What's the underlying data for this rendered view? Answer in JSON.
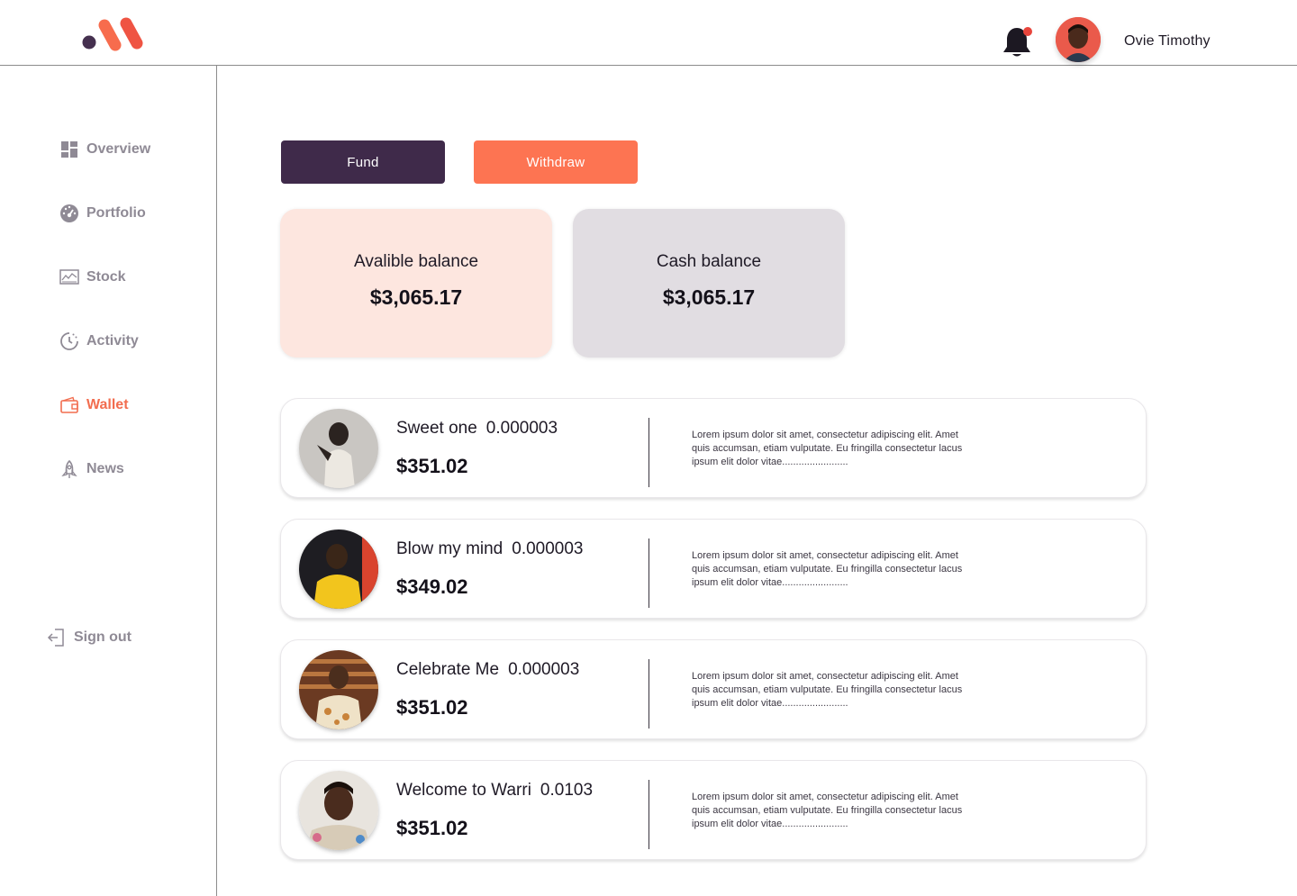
{
  "header": {
    "user_name": "Ovie Timothy",
    "notification_dot_color": "#e8453c"
  },
  "sidebar": {
    "items": [
      {
        "label": "Overview",
        "icon": "grid-icon",
        "active": false
      },
      {
        "label": "Portfolio",
        "icon": "dashboard-gauge-icon",
        "active": false
      },
      {
        "label": "Stock",
        "icon": "chart-screen-icon",
        "active": false
      },
      {
        "label": "Activity",
        "icon": "clock-icon",
        "active": false
      },
      {
        "label": "Wallet",
        "icon": "wallet-icon",
        "active": true
      },
      {
        "label": "News",
        "icon": "rocket-icon",
        "active": false
      }
    ],
    "signout_label": "Sign out"
  },
  "actions": {
    "fund_label": "Fund",
    "withdraw_label": "Withdraw"
  },
  "balances": {
    "available": {
      "label": "Avalible balance",
      "value": "$3,065.17"
    },
    "cash": {
      "label": "Cash balance",
      "value": "$3,065.17"
    }
  },
  "songs": [
    {
      "title": "Sweet one",
      "amount": "0.000003",
      "price": "$351.02",
      "description": "Lorem ipsum dolor sit amet, consectetur adipiscing elit. Amet quis accumsan, etiam vulputate. Eu fringilla consectetur lacus ipsum elit dolor vitae........................"
    },
    {
      "title": "Blow my mind",
      "amount": "0.000003",
      "price": "$349.02",
      "description": "Lorem ipsum dolor sit amet, consectetur adipiscing elit. Amet quis accumsan, etiam vulputate. Eu fringilla consectetur lacus ipsum elit dolor vitae........................"
    },
    {
      "title": "Celebrate Me",
      "amount": "0.000003",
      "price": "$351.02",
      "description": "Lorem ipsum dolor sit amet, consectetur adipiscing elit. Amet quis accumsan, etiam vulputate. Eu fringilla consectetur lacus ipsum elit dolor vitae........................"
    },
    {
      "title": "Welcome to Warri",
      "amount": "0.0103",
      "price": "$351.02",
      "description": "Lorem ipsum dolor sit amet, consectetur adipiscing elit. Amet quis accumsan, etiam vulputate. Eu fringilla consectetur lacus ipsum elit dolor vitae........................"
    }
  ],
  "colors": {
    "primary_dark": "#3f2a4a",
    "accent_orange": "#fd7452",
    "active_nav": "#f26d4f",
    "available_card_bg": "#fde6df",
    "cash_card_bg": "#e1dde2"
  }
}
